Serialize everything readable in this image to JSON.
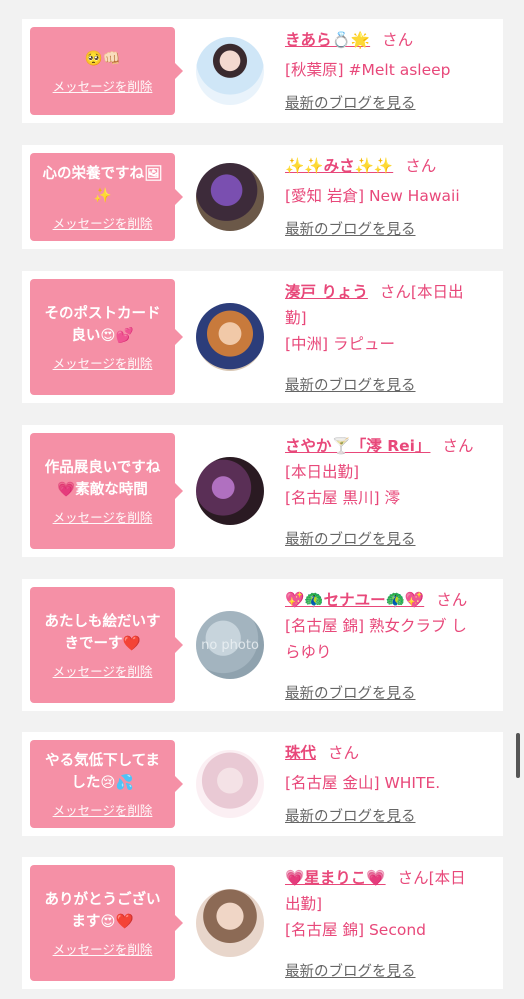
{
  "delete_label": "メッセージを削除",
  "blog_label": "最新のブログを見る",
  "san": "さん",
  "cards": [
    {
      "message": "🥺👊🏻",
      "name": "きあら💍🌟",
      "lines": [
        "[秋葉原] #Melt asleep"
      ],
      "avatar": "avatar-1"
    },
    {
      "message": "心の栄養ですね🖼✨",
      "name": "✨✨みさ✨✨",
      "lines": [
        "[愛知 岩倉] New Hawaii"
      ],
      "avatar": "avatar-2"
    },
    {
      "message": "そのポストカード良い😍💕",
      "name": "湊戸 りょう",
      "first_tail": "[本日出",
      "lines": [
        "勤]",
        "[中洲] ラピュー"
      ],
      "avatar": "avatar-3"
    },
    {
      "message": "作品展良いですね💗素敵な時間",
      "name": "さやか🍸「澪 Rei」",
      "lines": [
        "[本日出勤]",
        "[名古屋 黒川] 澪"
      ],
      "avatar": "avatar-4"
    },
    {
      "message": "あたしも絵だいすきでーす❤️",
      "name": "💖🦚セナユー🦚💖",
      "lines": [
        "[名古屋 錦] 熟女クラブ し",
        "らゆり"
      ],
      "avatar": "no-photo",
      "no_photo_text": "no photo"
    },
    {
      "message": "やる気低下してました😢💦",
      "name": "珠代",
      "lines": [
        "[名古屋 金山] WHITE."
      ],
      "avatar": "avatar-6"
    },
    {
      "message": "ありがとうございます😍❤️",
      "name": "💗星まりこ💗",
      "first_tail": "[本日",
      "lines": [
        "出勤]",
        "[名古屋 錦] Second"
      ],
      "avatar": "avatar-7"
    }
  ]
}
